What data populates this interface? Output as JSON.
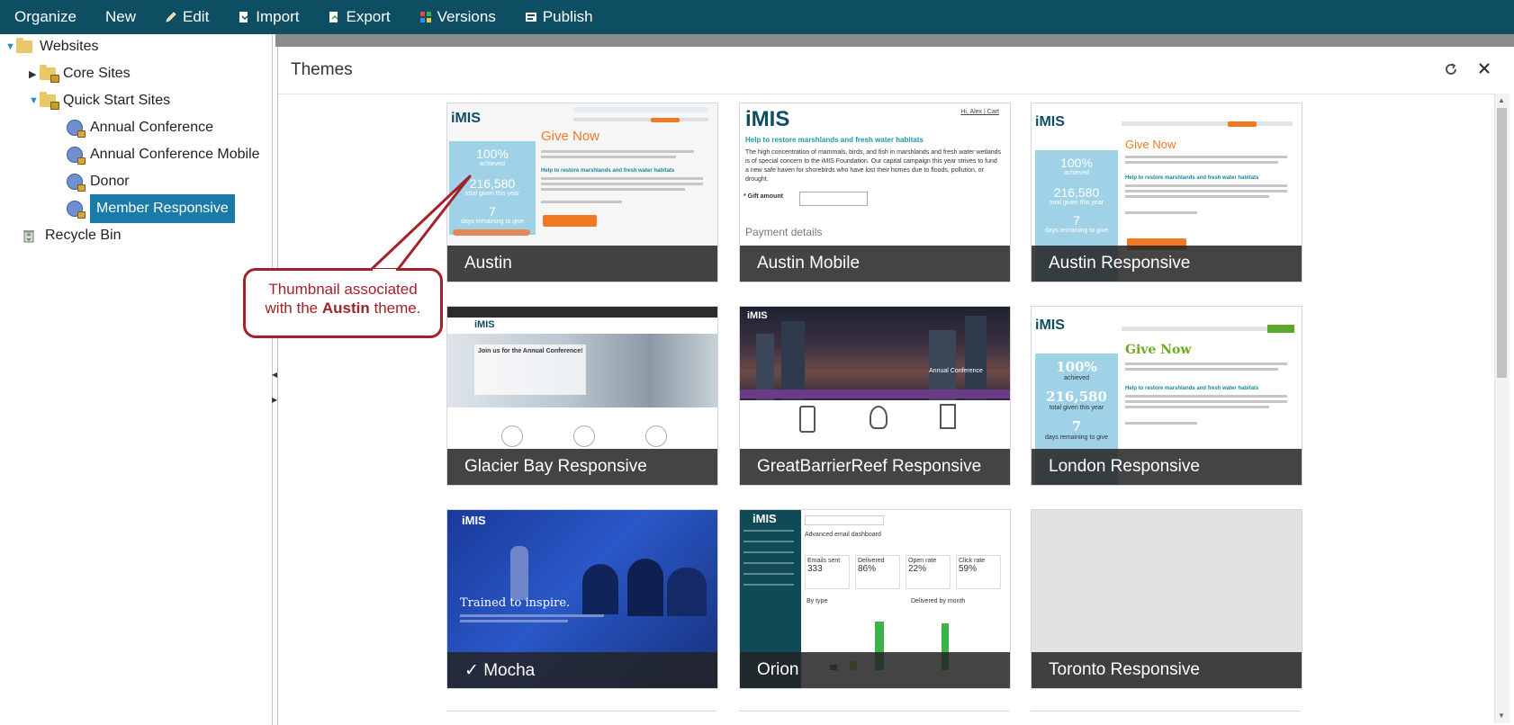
{
  "toolbar": {
    "organize": "Organize",
    "new": "New",
    "edit": "Edit",
    "import": "Import",
    "export": "Export",
    "versions": "Versions",
    "publish": "Publish"
  },
  "tree": {
    "websites": "Websites",
    "core_sites": "Core Sites",
    "quick_start_sites": "Quick Start Sites",
    "children": [
      "Annual Conference",
      "Annual Conference Mobile",
      "Donor",
      "Member Responsive"
    ],
    "recycle_bin": "Recycle Bin"
  },
  "dialog": {
    "title": "Themes"
  },
  "themes": [
    {
      "name": "Austin"
    },
    {
      "name": "Austin Mobile"
    },
    {
      "name": "Austin Responsive"
    },
    {
      "name": "Glacier Bay Responsive"
    },
    {
      "name": "GreatBarrierReef Responsive"
    },
    {
      "name": "London Responsive"
    },
    {
      "name": "✓ Mocha"
    },
    {
      "name": "Orion"
    },
    {
      "name": "Toronto Responsive"
    }
  ],
  "thumb_text": {
    "imis": "iMIS",
    "give_now": "Give Now",
    "pct": "100%",
    "achieved": "achieved",
    "amount": "216,580",
    "total_given": "total given this year",
    "days": "7",
    "days_remaining": "days remaining to give",
    "help_heading": "Help to restore marshlands and fresh water habitats",
    "mobile_body": "The high concentration of mammals, birds, and fish in marshlands and fresh water wetlands is of special concern to the iMIS Foundation. Our capital campaign this year strives to fund a new safe haven for shorebirds who have lost their homes due to floods, pollution, or drought.",
    "gift_amount": "* Gift amount",
    "payment_details": "Payment details",
    "hi_cart": "Hi, Alex | Cart",
    "glacier_heading": "Join us for the Annual Conference!",
    "annual_conference": "Annual Conference",
    "trained": "Trained to inspire.",
    "email_dash": "Advanced email dashboard",
    "emails_sent": "Emails sent",
    "emails_sent_val": "333",
    "delivered": "Delivered",
    "delivered_val": "86%",
    "open_rate": "Open rate",
    "open_rate_val": "22%",
    "click_rate": "Click rate",
    "click_rate_val": "59%",
    "by_type": "By type",
    "delivered_by_month": "Delivered by month"
  },
  "callout": {
    "line1": "Thumbnail associated",
    "line2_pre": "with the",
    "line2_bold": "Austin",
    "line2_post": "theme."
  },
  "colors": {
    "topbar": "#0d4e63",
    "selection": "#1a7aa8",
    "callout": "#a3212a",
    "caption_bg": "#232323"
  }
}
